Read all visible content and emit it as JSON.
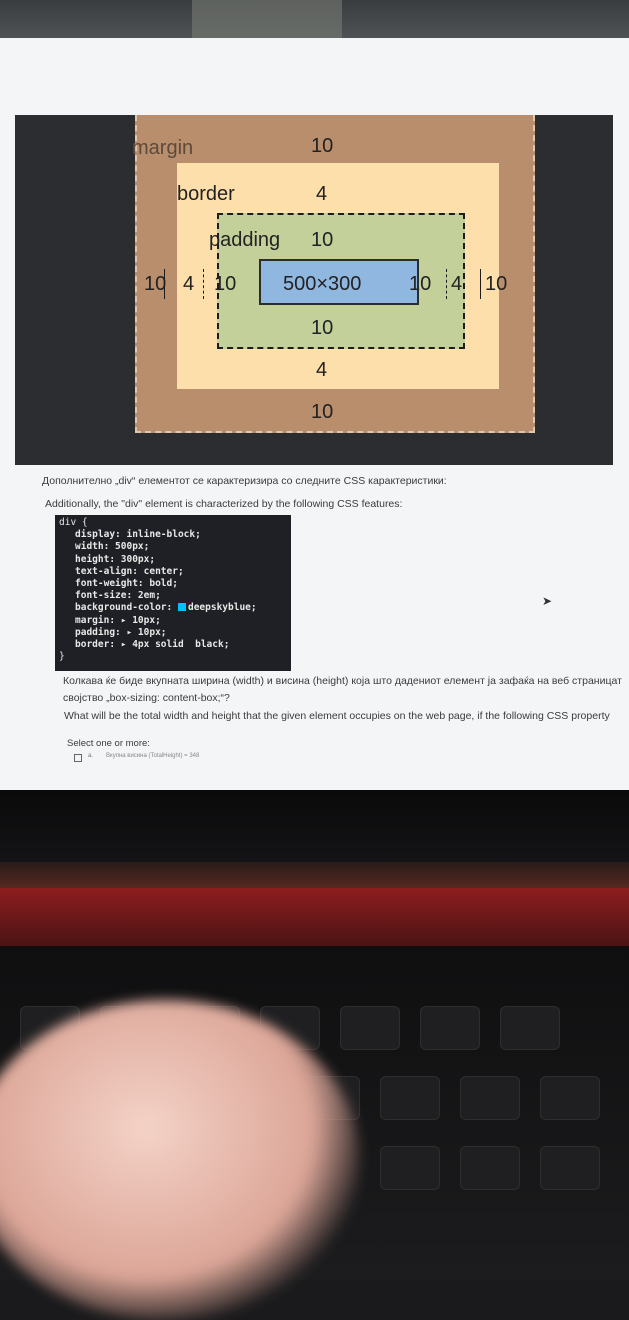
{
  "diagram": {
    "margin_label": "margin",
    "margin_top": "10",
    "margin_left": "10",
    "margin_right": "10",
    "margin_bottom": "10",
    "border_label": "border",
    "border_top": "4",
    "border_left": "4",
    "border_right": "4",
    "border_bottom": "4",
    "padding_label": "padding",
    "padding_top": "10",
    "padding_left": "10",
    "padding_right": "10",
    "padding_bottom": "10",
    "content_size": "500×300"
  },
  "question": {
    "intro_mk": "Дополнително „div“ елементот се карактеризира со следните CSS карактеристики:",
    "intro_en": "Additionally, the \"div\" element is characterized by the following CSS features:",
    "code_lines": {
      "open": "div {",
      "display": "display: inline-block;",
      "width": "width: 500px;",
      "height": "height: 300px;",
      "text_align": "text-align: center;",
      "font_weight": "font-weight: bold;",
      "font_size": "font-size: 2em;",
      "bg_prefix": "background-color:",
      "bg_value": "deepskyblue;",
      "margin": "margin: ▸ 10px;",
      "padding": "padding: ▸ 10px;",
      "border": "border: ▸ 4px solid  black;",
      "close": "}"
    },
    "swatch_color": "#00bfff",
    "prompt_mk_1": "Колкава ќе биде вкупната ширина (width) и висина (height) која што дадениот елемент ја зафаќа на веб страницат",
    "prompt_mk_2": "својство „box-sizing: content-box;“?",
    "prompt_en": "What will be the total width and height that the given element occupies on the web page, if the following CSS property",
    "select_label": "Select one or more:",
    "option_a_prefix": "a.",
    "option_a_text": "Вкупна висина (TotalHeight) = 348"
  }
}
